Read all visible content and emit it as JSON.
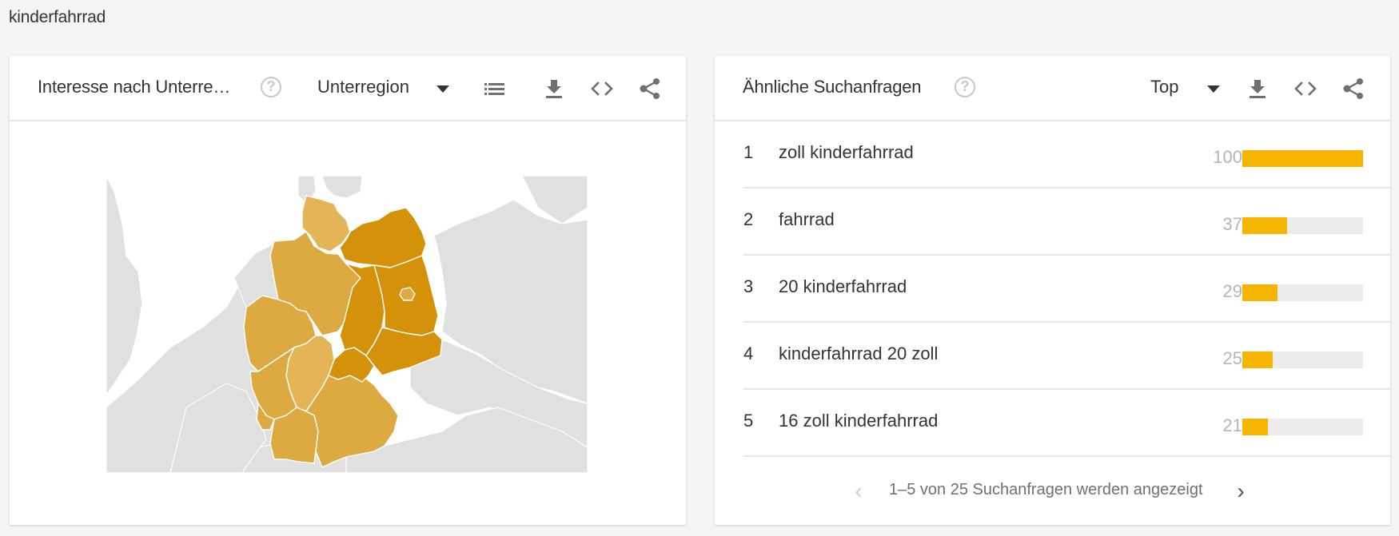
{
  "query": "kinderfahrrad",
  "colors": {
    "accent_bar": "#f4b400",
    "bar_track": "#ececec",
    "map_level_high": "#d4920b",
    "map_level_mid": "#dda941",
    "map_level_low": "#e3b556",
    "map_background_land": "#e0e0e0",
    "map_water": "#ffffff",
    "icon_gray": "#707070"
  },
  "left_card": {
    "title": "Interesse nach Unterre…",
    "help_icon": "help-circle-icon",
    "dropdown_label": "Unterregion",
    "icons": [
      "list-icon",
      "download-icon",
      "embed-code-icon",
      "share-icon"
    ],
    "map": {
      "country": "Deutschland",
      "regions": [
        {
          "name": "Mecklenburg-Vorpommern",
          "level": "high"
        },
        {
          "name": "Brandenburg",
          "level": "high"
        },
        {
          "name": "Berlin",
          "level": "mid"
        },
        {
          "name": "Sachsen-Anhalt",
          "level": "high"
        },
        {
          "name": "Thüringen",
          "level": "high"
        },
        {
          "name": "Sachsen",
          "level": "high"
        },
        {
          "name": "Schleswig-Holstein",
          "level": "low"
        },
        {
          "name": "Niedersachsen",
          "level": "mid"
        },
        {
          "name": "Nordrhein-Westfalen",
          "level": "mid"
        },
        {
          "name": "Hessen",
          "level": "low"
        },
        {
          "name": "Rheinland-Pfalz",
          "level": "mid"
        },
        {
          "name": "Saarland",
          "level": "mid"
        },
        {
          "name": "Baden-Württemberg",
          "level": "mid"
        },
        {
          "name": "Bayern",
          "level": "mid"
        }
      ]
    }
  },
  "right_card": {
    "title": "Ähnliche Suchanfragen",
    "help_icon": "help-circle-icon",
    "dropdown_label": "Top",
    "icons": [
      "download-icon",
      "embed-code-icon",
      "share-icon"
    ],
    "rows": [
      {
        "rank": "1",
        "label": "zoll kinderfahrrad",
        "value": "100",
        "percent": 100
      },
      {
        "rank": "2",
        "label": "fahrrad",
        "value": "37",
        "percent": 37
      },
      {
        "rank": "3",
        "label": "20 kinderfahrrad",
        "value": "29",
        "percent": 29
      },
      {
        "rank": "4",
        "label": "kinderfahrrad 20 zoll",
        "value": "25",
        "percent": 25
      },
      {
        "rank": "5",
        "label": "16 zoll kinderfahrrad",
        "value": "21",
        "percent": 21
      }
    ],
    "pagination": {
      "text": "1–5 von 25 Suchanfragen werden angezeigt",
      "prev_icon": "‹",
      "next_icon": "›",
      "prev_enabled": false,
      "next_enabled": true
    }
  }
}
